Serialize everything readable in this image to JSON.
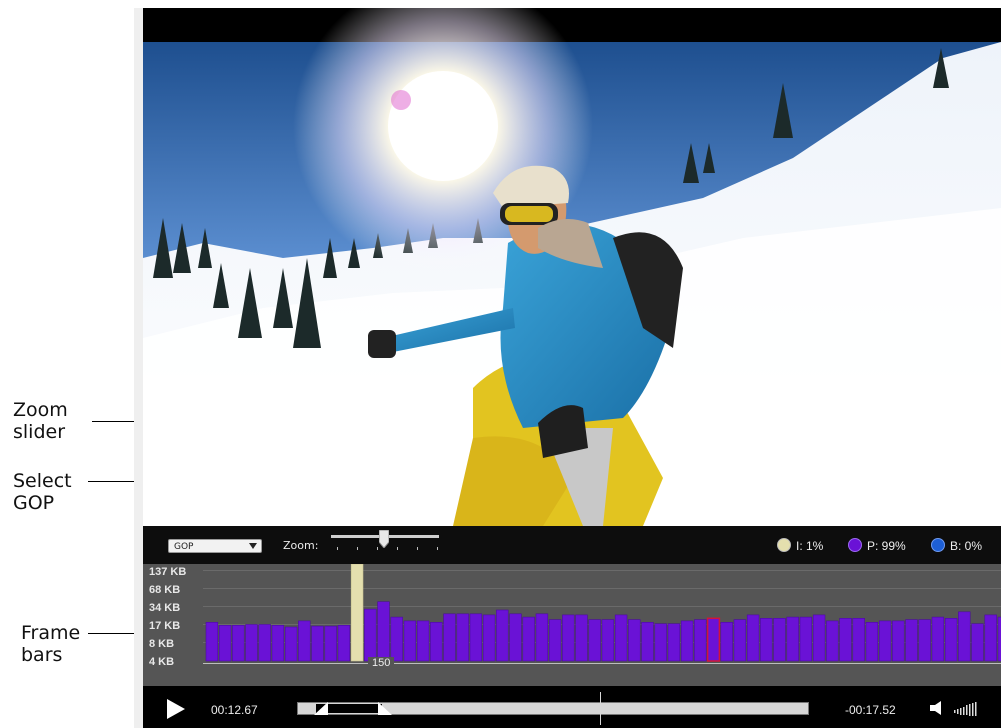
{
  "callouts": {
    "zoom_slider": "Zoom slider",
    "select_gop": "Select GOP",
    "frame_bars": "Frame bars"
  },
  "controls": {
    "gop_select_value": "GOP",
    "zoom_label": "Zoom:",
    "zoom_level": 0.49
  },
  "legend": [
    {
      "label": "I: 1%",
      "color": "#e4dfae"
    },
    {
      "label": "P: 99%",
      "color": "#6a12d6"
    },
    {
      "label": "B: 0%",
      "color": "#1d5fd6"
    }
  ],
  "chart_data": {
    "type": "bar",
    "y_tick_labels": [
      "137 KB",
      "68 KB",
      "34 KB",
      "17 KB",
      "8 KB",
      "4 KB"
    ],
    "y_ticks_kb": [
      137,
      68,
      34,
      17,
      8,
      4
    ],
    "frame_marker_label": "150",
    "series": [
      {
        "name": "P",
        "color": "#6a12d6"
      }
    ],
    "frames": [
      {
        "type": "P",
        "kb": 18
      },
      {
        "type": "P",
        "kb": 16
      },
      {
        "type": "P",
        "kb": 16
      },
      {
        "type": "P",
        "kb": 16.5
      },
      {
        "type": "P",
        "kb": 16.5
      },
      {
        "type": "P",
        "kb": 16
      },
      {
        "type": "P",
        "kb": 15
      },
      {
        "type": "P",
        "kb": 19
      },
      {
        "type": "P",
        "kb": 15.5
      },
      {
        "type": "P",
        "kb": 15.5
      },
      {
        "type": "P",
        "kb": 16
      },
      {
        "type": "I",
        "kb": 137
      },
      {
        "type": "P",
        "kb": 30
      },
      {
        "type": "P",
        "kb": 40
      },
      {
        "type": "P",
        "kb": 22
      },
      {
        "type": "P",
        "kb": 19
      },
      {
        "type": "P",
        "kb": 19
      },
      {
        "type": "P",
        "kb": 18
      },
      {
        "type": "P",
        "kb": 25
      },
      {
        "type": "P",
        "kb": 25
      },
      {
        "type": "P",
        "kb": 25
      },
      {
        "type": "P",
        "kb": 24
      },
      {
        "type": "P",
        "kb": 29
      },
      {
        "type": "P",
        "kb": 25
      },
      {
        "type": "P",
        "kb": 22
      },
      {
        "type": "P",
        "kb": 25
      },
      {
        "type": "P",
        "kb": 20
      },
      {
        "type": "P",
        "kb": 24
      },
      {
        "type": "P",
        "kb": 24
      },
      {
        "type": "P",
        "kb": 20
      },
      {
        "type": "P",
        "kb": 20
      },
      {
        "type": "P",
        "kb": 24
      },
      {
        "type": "P",
        "kb": 20
      },
      {
        "type": "P",
        "kb": 18
      },
      {
        "type": "P",
        "kb": 17
      },
      {
        "type": "P",
        "kb": 17
      },
      {
        "type": "P",
        "kb": 19
      },
      {
        "type": "P",
        "kb": 20
      },
      {
        "type": "P",
        "kb": 21,
        "selected": true
      },
      {
        "type": "P",
        "kb": 18
      },
      {
        "type": "P",
        "kb": 20
      },
      {
        "type": "P",
        "kb": 24
      },
      {
        "type": "P",
        "kb": 21
      },
      {
        "type": "P",
        "kb": 21
      },
      {
        "type": "P",
        "kb": 22
      },
      {
        "type": "P",
        "kb": 22
      },
      {
        "type": "P",
        "kb": 24
      },
      {
        "type": "P",
        "kb": 19
      },
      {
        "type": "P",
        "kb": 21
      },
      {
        "type": "P",
        "kb": 21
      },
      {
        "type": "P",
        "kb": 18
      },
      {
        "type": "P",
        "kb": 19
      },
      {
        "type": "P",
        "kb": 19
      },
      {
        "type": "P",
        "kb": 20
      },
      {
        "type": "P",
        "kb": 20
      },
      {
        "type": "P",
        "kb": 22
      },
      {
        "type": "P",
        "kb": 21
      },
      {
        "type": "P",
        "kb": 27
      },
      {
        "type": "P",
        "kb": 17
      },
      {
        "type": "P",
        "kb": 24
      },
      {
        "type": "P",
        "kb": 22
      }
    ]
  },
  "transport": {
    "current_time": "00:12.67",
    "remaining_time": "-00:17.52"
  }
}
